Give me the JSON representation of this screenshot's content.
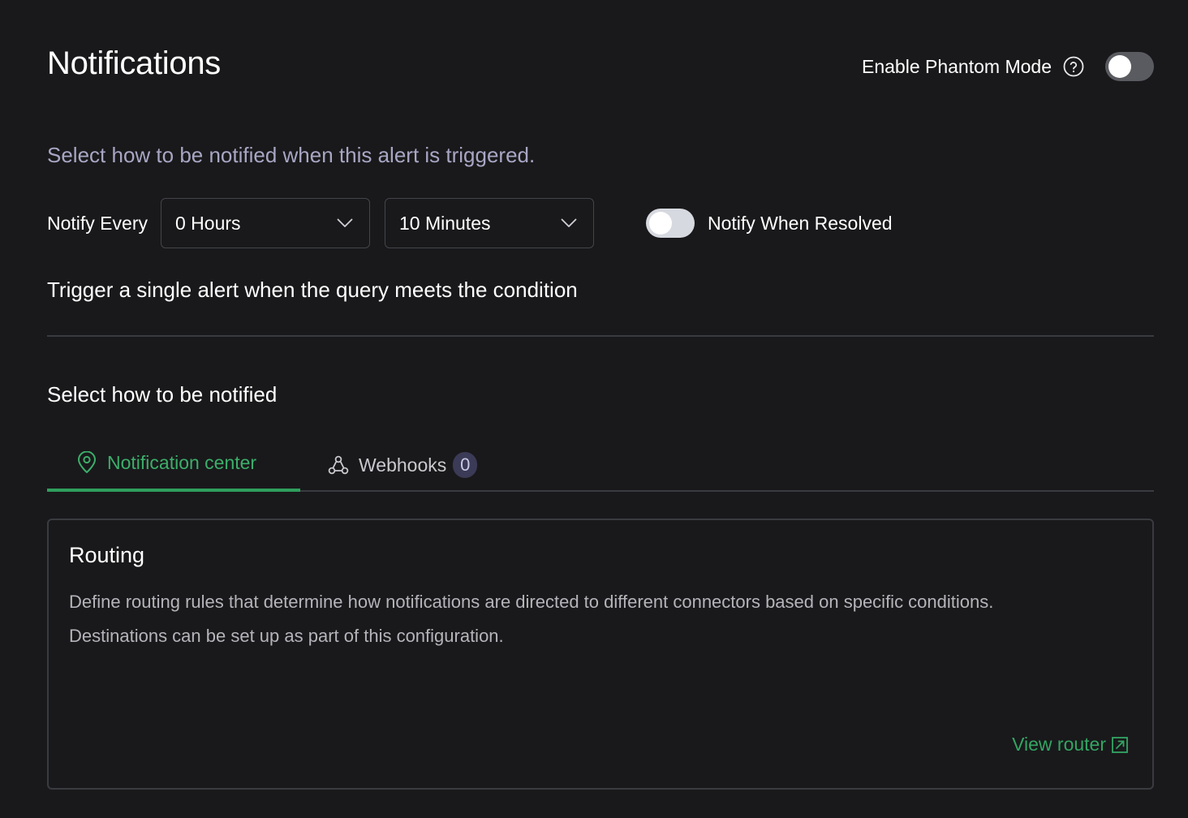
{
  "header": {
    "title": "Notifications",
    "phantom_label": "Enable Phantom Mode"
  },
  "settings": {
    "subtitle": "Select how to be notified when this alert is triggered.",
    "notify_label": "Notify Every",
    "hours_value": "0 Hours",
    "minutes_value": "10 Minutes",
    "resolved_label": "Notify When Resolved",
    "trigger_text": "Trigger a single alert when the query meets the condition"
  },
  "notify_section": {
    "title": "Select how to be notified",
    "tabs": [
      {
        "label": "Notification center",
        "icon": "location-pin-icon",
        "active": true
      },
      {
        "label": "Webhooks",
        "icon": "webhook-icon",
        "badge": "0",
        "active": false
      }
    ]
  },
  "routing": {
    "title": "Routing",
    "description_line1": "Define routing rules that determine how notifications are directed to different connectors based on specific conditions.",
    "description_line2": "Destinations can be set up as part of this configuration.",
    "link_label": "View router"
  },
  "colors": {
    "background": "#19191b",
    "accent_green": "#3cae6a",
    "subtitle_purple": "#a8a6c4",
    "border": "#3a3b40"
  }
}
